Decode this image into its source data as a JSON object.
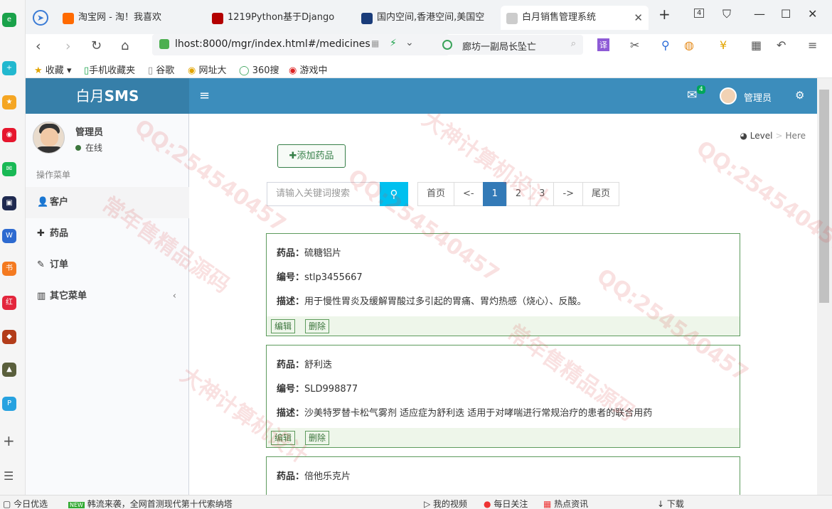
{
  "browser": {
    "tabs": [
      {
        "title": "淘宝网 - 淘！我喜欢",
        "fav_color": "#ff6a00"
      },
      {
        "title": "1219Python基于Django",
        "fav_color": "#b30000"
      },
      {
        "title": "国内空间,香港空间,美国空",
        "fav_color": "#1a3c7a"
      },
      {
        "title": "白月销售管理系统",
        "fav_color": "#cccccc"
      }
    ],
    "tab_count": "4",
    "url": "lhost:8000/mgr/index.html#/medicines",
    "search_text": "廊坊一副局长坠亡",
    "bookmarks": [
      "收藏",
      "手机收藏夹",
      "谷歌",
      "网址大",
      "360搜",
      "游戏中"
    ]
  },
  "header": {
    "logo_light": "白月",
    "logo_bold": "SMS",
    "mail_badge": "4",
    "user": "管理员"
  },
  "sidebar": {
    "user_name": "管理员",
    "status": "在线",
    "menu_header": "操作菜单",
    "items": [
      {
        "label": "客户",
        "icon": "user-icon"
      },
      {
        "label": "药品",
        "icon": "plus-icon"
      },
      {
        "label": "订单",
        "icon": "paperclip-icon"
      },
      {
        "label": "其它菜单",
        "icon": "bar-chart-icon"
      }
    ]
  },
  "breadcrumb": {
    "level": "Level",
    "here": "Here"
  },
  "toolbar": {
    "add_label": "添加药品",
    "search_placeholder": "请输入关键词搜索"
  },
  "pagination": [
    "首页",
    "<-",
    "1",
    "2",
    "3",
    "->",
    "尾页"
  ],
  "pagination_current": "1",
  "labels": {
    "name": "药品：",
    "sn": "编号：",
    "desc": "描述：",
    "edit": "编辑",
    "delete": "删除"
  },
  "medicines": [
    {
      "name": "硫糖铝片",
      "sn": "stlp3455667",
      "desc": "用于慢性胃炎及缓解胃酸过多引起的胃痛、胃灼热感（烧心）、反酸。"
    },
    {
      "name": "舒利迭",
      "sn": "SLD998877",
      "desc": "沙美特罗替卡松气雾剂 适应症为舒利迭 适用于对哮喘进行常规治疗的患者的联合用药"
    },
    {
      "name": "倍他乐克片",
      "sn": "",
      "desc": ""
    }
  ],
  "statusbar": {
    "left1": "今日优选",
    "news": "韩流来袭，全网首测现代第十代索纳塔",
    "video": "我的视频",
    "follow": "每日关注",
    "hot": "热点资讯",
    "download": "下载"
  },
  "watermarks": [
    "QQ:254540457",
    "大神计算机设计",
    "常年售精品源码"
  ]
}
